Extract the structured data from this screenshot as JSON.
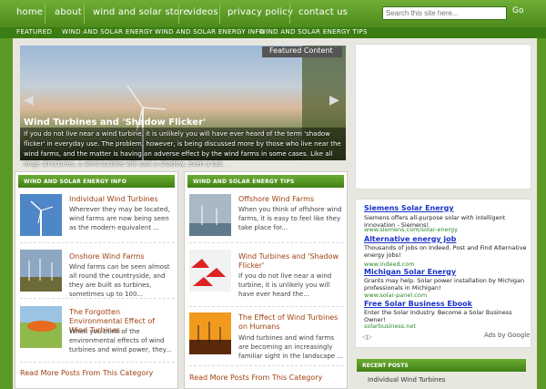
{
  "topnav": {
    "items": [
      "home",
      "about",
      "wind and solar store",
      "videos",
      "privacy policy",
      "contact us"
    ],
    "search_placeholder": "Search this site here...",
    "go": "Go"
  },
  "subnav": {
    "items": [
      "FEATURED",
      "WIND AND SOLAR ENERGY",
      "WIND AND SOLAR ENERGY INFO",
      "WIND AND SOLAR ENERGY TIPS"
    ]
  },
  "featured": {
    "tag": "Featured Content",
    "title": "Wind Turbines and 'Shadow Flicker'",
    "text": "If you do not live near a wind turbine, it is unlikely you will have ever heard of the term 'shadow flicker' in everyday use. The problem, however, is being discussed more by those who live near the wind farms, and the matter is having an adverse effect by the wind farms in some cases. Like all large structures, a wind turbine will cast a shadow, even a tall."
  },
  "info": {
    "heading": "WIND AND SOLAR ENERGY INFO",
    "posts": [
      {
        "title": "Individual Wind Turbines",
        "text": "Wherever they may be located, wind farms are now being seen as the modern equivalent ..."
      },
      {
        "title": "Onshore Wind Farms",
        "text": "Wind farms can be seen almost all round the countryside, and they are built as turbines, sometimes up to 100..."
      },
      {
        "title": "The Forgotten Environmental Effect of Wind Turbines",
        "text": "When you think of the environmental effects of wind turbines and wind power, they..."
      }
    ],
    "more": "Read More Posts From This Category"
  },
  "tips": {
    "heading": "WIND AND SOLAR ENERGY TIPS",
    "posts": [
      {
        "title": "Offshore Wind Farms",
        "text": "When you think of offshore wind farms, it is easy to feel like they take place for..."
      },
      {
        "title": "Wind Turbines and 'Shadow Flicker'",
        "text": "If you do not live near a wind turbine, it is unlikely you will have ever heard the..."
      },
      {
        "title": "The Effect of Wind Turbines on Humans",
        "text": "Wind turbines and wind farms are becoming an increasingly familiar sight in the landscape ..."
      }
    ],
    "more": "Read More Posts From This Category"
  },
  "ads": [
    {
      "title": "Siemens Solar Energy",
      "text": "Siemens offers all-purpose solar with intelligent innovation - Siemens!",
      "url": "www.siemens.com/solar-energy"
    },
    {
      "title": "Alternative energy job",
      "text": "Thousands of jobs on Indeed. Post and Find Alternative energy jobs!",
      "url": "www.indeed.com"
    },
    {
      "title": "Michigan Solar Energy",
      "text": "Grants may help. Solar power installation by Michigan professionals in Michigan!",
      "url": "www.solar-panel.com"
    },
    {
      "title": "Free Solar Business Ebook",
      "text": "Enter the Solar Industry. Become a Solar Business Owner!",
      "url": "solarbusiness.net"
    }
  ],
  "adchoices": "Ads by Google",
  "recent": {
    "heading": "RECENT POSTS",
    "first": "Individual Wind Turbines"
  }
}
